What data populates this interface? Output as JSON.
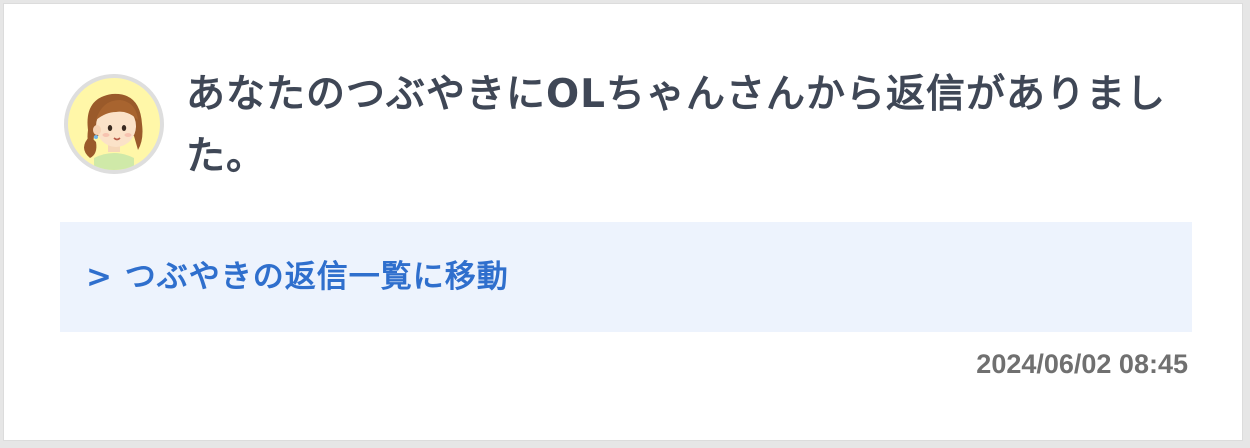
{
  "notification": {
    "avatar_icon": "ol-chan-avatar-icon",
    "message": "あなたのつぶやきにOLちゃんさんから返信がありました。",
    "link_label": "> つぶやきの返信一覧に移動",
    "timestamp": "2024/06/02 08:45"
  },
  "colors": {
    "message_text": "#3f4756",
    "link_text": "#2f6fcd",
    "link_background": "#edf3fd",
    "avatar_background": "#fff7a8",
    "timestamp_text": "#707070"
  }
}
